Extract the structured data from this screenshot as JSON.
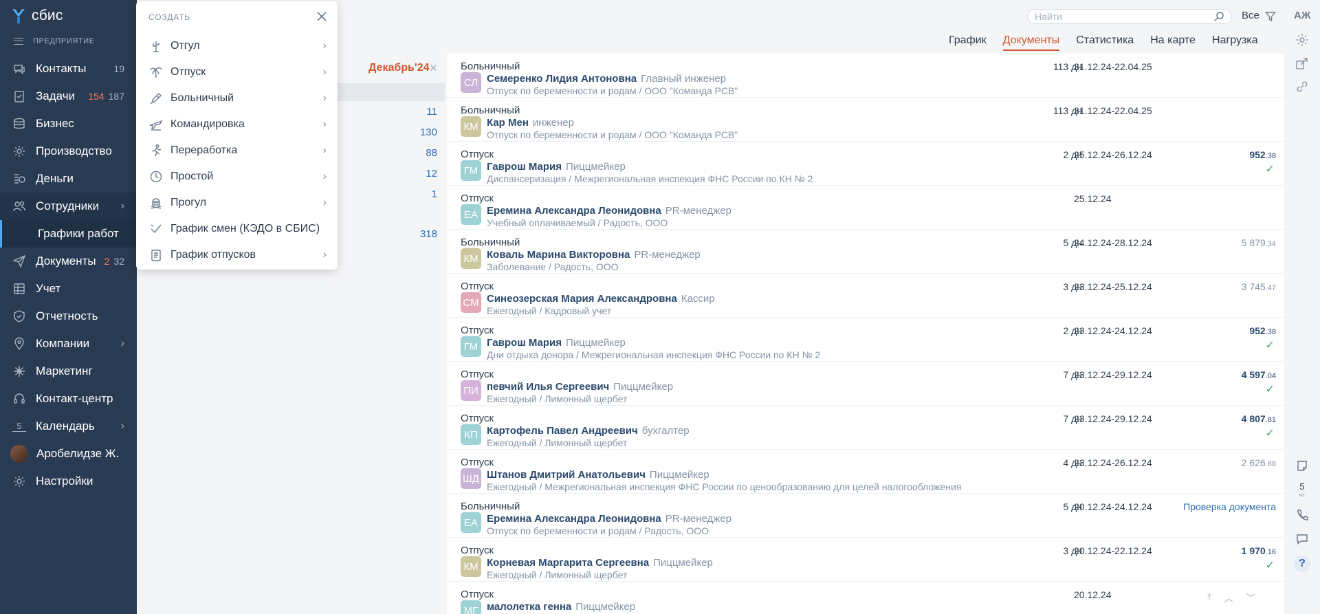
{
  "app": {
    "logo": "сбис"
  },
  "sidebar": {
    "section": "ПРЕДПРИЯТИЕ",
    "items": [
      {
        "label": "Контакты",
        "count": "19",
        "icon": "chat-icon"
      },
      {
        "label": "Задачи",
        "count_red": "154",
        "count": "187",
        "icon": "tasks-icon"
      },
      {
        "label": "Бизнес",
        "icon": "database-icon"
      },
      {
        "label": "Производство",
        "icon": "gear-icon"
      },
      {
        "label": "Деньги",
        "icon": "coins-icon"
      },
      {
        "label": "Сотрудники",
        "icon": "users-icon",
        "expanded": true
      },
      {
        "label": "Документы",
        "count_red": "2",
        "count": "32",
        "icon": "send-icon"
      },
      {
        "label": "Учет",
        "icon": "grid-icon"
      },
      {
        "label": "Отчетность",
        "icon": "shield-icon"
      },
      {
        "label": "Компании",
        "icon": "location-icon"
      },
      {
        "label": "Маркетинг",
        "icon": "sparkle-icon"
      },
      {
        "label": "Контакт-центр",
        "icon": "headset-icon"
      },
      {
        "label": "Календарь",
        "icon": "calendar-icon",
        "day": "5"
      },
      {
        "label": "Аробелидзе Ж.",
        "icon": "avatar"
      },
      {
        "label": "Настройки",
        "icon": "settings-icon"
      }
    ],
    "subitem": "Графики работ"
  },
  "left_panel": {
    "period": "Декабрь'24",
    "counts": [
      "11",
      "130",
      "88",
      "12",
      "1",
      "318"
    ]
  },
  "search": {
    "placeholder": "Найти"
  },
  "filter": {
    "label": "Все"
  },
  "user": {
    "initials": "АЖ"
  },
  "tabs": [
    "График",
    "Документы",
    "Статистика",
    "На карте",
    "Нагрузка"
  ],
  "active_tab": "Документы",
  "popup": {
    "title": "СОЗДАТЬ",
    "items": [
      {
        "label": "Отгул",
        "icon": "cactus-icon",
        "arrow": true
      },
      {
        "label": "Отпуск",
        "icon": "palm-icon",
        "arrow": true
      },
      {
        "label": "Больничный",
        "icon": "thermometer-icon",
        "arrow": true
      },
      {
        "label": "Командировка",
        "icon": "airplane-icon",
        "arrow": true
      },
      {
        "label": "Переработка",
        "icon": "runner-icon",
        "arrow": true
      },
      {
        "label": "Простой",
        "icon": "clock-icon",
        "arrow": true
      },
      {
        "label": "Прогул",
        "icon": "skull-icon",
        "arrow": true
      },
      {
        "label": "График смен (КЭДО в СБИС)",
        "icon": "checkmark-icon",
        "arrow": false
      },
      {
        "label": "График отпусков",
        "icon": "document-icon",
        "arrow": true
      }
    ]
  },
  "documents": [
    {
      "type": "Больничный",
      "initials": "СЛ",
      "color": "#c9b3d6",
      "name": "Семеренко Лидия Антоновна",
      "position": "Главный инженер",
      "sub": "Отпуск по беременности и родам / ООО \"Команда РСВ\"",
      "days": "113 дн",
      "dates": "31.12.24-22.04.25"
    },
    {
      "type": "Больничный",
      "initials": "КМ",
      "color": "#cdc79e",
      "name": "Кар Мен",
      "position": "инженер",
      "sub": "Отпуск по беременности и родам / ООО \"Команда РСВ\"",
      "days": "113 дн",
      "dates": "31.12.24-22.04.25"
    },
    {
      "type": "Отпуск",
      "initials": "ГМ",
      "color": "#9ed3d6",
      "name": "Гаврош Мария",
      "position": "Пиццмейкер",
      "sub": "Диспансеризация / Межрегиональная инспекция ФНС России по КН № 2",
      "days": "2 дн",
      "dates": "25.12.24-26.12.24",
      "sum": "952",
      "frac": ".38",
      "dark": true,
      "check": true
    },
    {
      "type": "Отпуск",
      "initials": "ЕА",
      "color": "#9ed3d6",
      "name": "Еремина Александра Леонидовна",
      "position": "PR-менеджер",
      "sub": "Учебный оплачиваемый / Радость, ООО",
      "days": "",
      "dates": "25.12.24"
    },
    {
      "type": "Больничный",
      "initials": "КМ",
      "color": "#cdc79e",
      "name": "Коваль Марина Викторовна",
      "position": "PR-менеджер",
      "sub": "Заболевание / Радость, ООО",
      "days": "5 дн",
      "dates": "24.12.24-28.12.24",
      "sum": "5 879",
      "frac": ".34"
    },
    {
      "type": "Отпуск",
      "initials": "СМ",
      "color": "#e4a9b6",
      "name": "Синеозерская Мария Александровна",
      "position": "Кассир",
      "sub": "Ежегодный / Кадровый учет",
      "days": "3 дн",
      "dates": "23.12.24-25.12.24",
      "sum": "3 745",
      "frac": ".47"
    },
    {
      "type": "Отпуск",
      "initials": "ГМ",
      "color": "#9ed3d6",
      "name": "Гаврош Мария",
      "position": "Пиццмейкер",
      "sub": "Дни отдыха донора / Межрегиональная инспекция ФНС России по КН № 2",
      "days": "2 дн",
      "dates": "23.12.24-24.12.24",
      "sum": "952",
      "frac": ".38",
      "dark": true,
      "check": true
    },
    {
      "type": "Отпуск",
      "initials": "ПИ",
      "color": "#d6b3da",
      "name": "певчий Илья Сергеевич",
      "position": "Пиццмейкер",
      "sub": "Ежегодный / Лимонный щербет",
      "days": "7 дн",
      "dates": "23.12.24-29.12.24",
      "sum": "4 597",
      "frac": ".04",
      "dark": true,
      "check": true
    },
    {
      "type": "Отпуск",
      "initials": "КП",
      "color": "#9ed3d6",
      "name": "Картофель Павел Андреевич",
      "position": "бухгалтер",
      "sub": "Ежегодный / Лимонный щербет",
      "days": "7 дн",
      "dates": "23.12.24-29.12.24",
      "sum": "4 807",
      "frac": ".81",
      "dark": true,
      "check": true
    },
    {
      "type": "Отпуск",
      "initials": "ШД",
      "color": "#c9b3d6",
      "name": "Штанов Дмитрий Анатольевич",
      "position": "Пиццмейкер",
      "sub": "Ежегодный / Межрегиональная инспекция ФНС России по ценообразованию для целей налогообложения",
      "days": "4 дн",
      "dates": "23.12.24-26.12.24",
      "sum": "2 626",
      "frac": ".88"
    },
    {
      "type": "Больничный",
      "initials": "ЕА",
      "color": "#9ed3d6",
      "name": "Еремина Александра Леонидовна",
      "position": "PR-менеджер",
      "sub": "Отпуск по беременности и родам / Радость, ООО",
      "days": "5 дн",
      "dates": "20.12.24-24.12.24",
      "link": "Проверка документа"
    },
    {
      "type": "Отпуск",
      "initials": "КМ",
      "color": "#cdc79e",
      "name": "Корневая Маргарита Сергеевна",
      "position": "Пиццмейкер",
      "sub": "Ежегодный / Лимонный щербет",
      "days": "3 дн",
      "dates": "20.12.24-22.12.24",
      "sum": "1 970",
      "frac": ".16",
      "dark": true,
      "check": true
    },
    {
      "type": "Отпуск",
      "initials": "МГ",
      "color": "#9ed3d6",
      "name": "малолетка генна",
      "position": "Пиццмейкер",
      "sub": "",
      "days": "",
      "dates": "20.12.24"
    }
  ],
  "calendar_widget": {
    "day": "5",
    "weekday": "чт"
  },
  "help": "?"
}
